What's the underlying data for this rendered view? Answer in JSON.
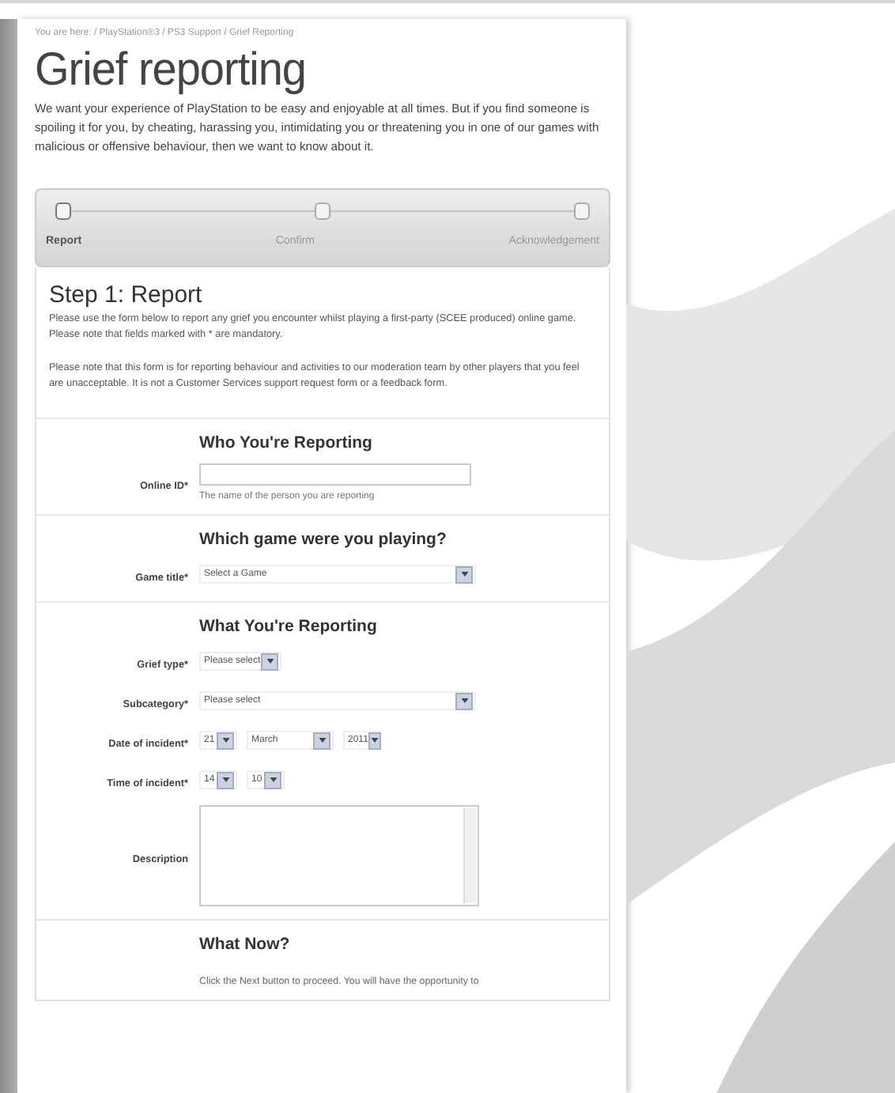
{
  "breadcrumb": "You are here: / PlayStation®3 / PS3 Support / Grief Reporting",
  "title": "Grief reporting",
  "intro": "We want your experience of PlayStation to be easy and enjoyable at all times. But if you find someone is spoiling it for you, by cheating, harassing you, intimidating you or threatening you in one of our games with malicious or offensive behaviour, then we want to know about it.",
  "steps": [
    {
      "label": "Report",
      "selected": true
    },
    {
      "label": "Confirm",
      "selected": false
    },
    {
      "label": "Acknowledgement",
      "selected": false
    }
  ],
  "step_panel": {
    "title": "Step 1: Report",
    "paragraphs": [
      "Please use the form below to report any grief you encounter whilst playing a first-party (SCEE produced) online game. Please note that fields marked with * are mandatory.",
      "Please note that this form is for reporting behaviour and activities to our moderation team by other players that you feel are unacceptable. It is not a Customer Services support request form or a feedback form."
    ]
  },
  "sections": [
    {
      "heading": "Who You're Reporting",
      "fields": [
        {
          "kind": "text",
          "label": "Online ID*",
          "hint": "The name of the person you are reporting"
        }
      ]
    },
    {
      "heading": "Which game were you playing?",
      "fields": [
        {
          "kind": "select",
          "label": "Game title*",
          "value": "Select a Game",
          "full": true
        }
      ]
    },
    {
      "heading": "What You're Reporting",
      "fields": [
        {
          "kind": "select",
          "label": "Grief type*",
          "value": "Please select",
          "full": false
        },
        {
          "kind": "select",
          "label": "Subcategory*",
          "value": "Please select",
          "full": true
        },
        {
          "kind": "multi",
          "label": "Date of incident*",
          "values": [
            "21",
            "March",
            "2011"
          ]
        },
        {
          "kind": "multi",
          "label": "Time of incident*",
          "values": [
            "14",
            "10"
          ]
        },
        {
          "kind": "textarea",
          "label": "Description"
        }
      ]
    },
    {
      "heading": "What Now?",
      "text": "Click the Next button to proceed. You will have the opportunity to"
    }
  ]
}
